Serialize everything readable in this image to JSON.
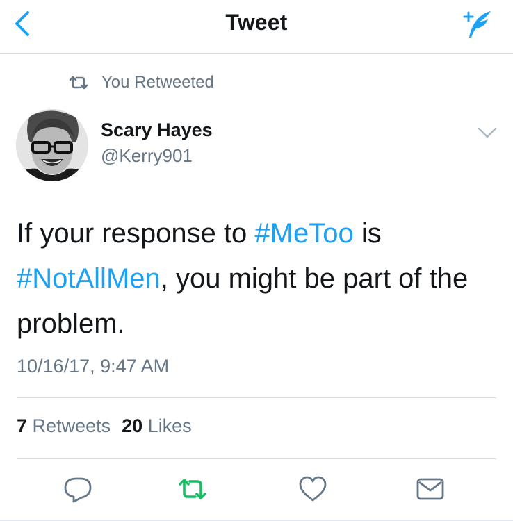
{
  "nav": {
    "title": "Tweet"
  },
  "context": {
    "label": "You Retweeted"
  },
  "author": {
    "name": "Scary Hayes",
    "handle": "@Kerry901"
  },
  "tweet": {
    "text_before": "If your response to ",
    "hashtag1": "#MeToo",
    "text_middle": " is ",
    "hashtag2": "#NotAllMen",
    "text_after": ", you might be part of the problem.",
    "timestamp": "10/16/17, 9:47 AM"
  },
  "stats": {
    "retweets_count": "7",
    "retweets_label": "Retweets",
    "likes_count": "20",
    "likes_label": "Likes"
  },
  "colors": {
    "accent": "#1da1f2",
    "retweet_active": "#17bf63",
    "muted": "#657786",
    "text": "#14171a"
  },
  "icons": {
    "back": "chevron-left-icon",
    "compose": "compose-tweet-icon",
    "retweeted": "retweet-icon",
    "menu": "chevron-down-icon",
    "reply": "reply-icon",
    "retweet": "retweet-icon",
    "like": "heart-icon",
    "dm": "envelope-icon"
  }
}
